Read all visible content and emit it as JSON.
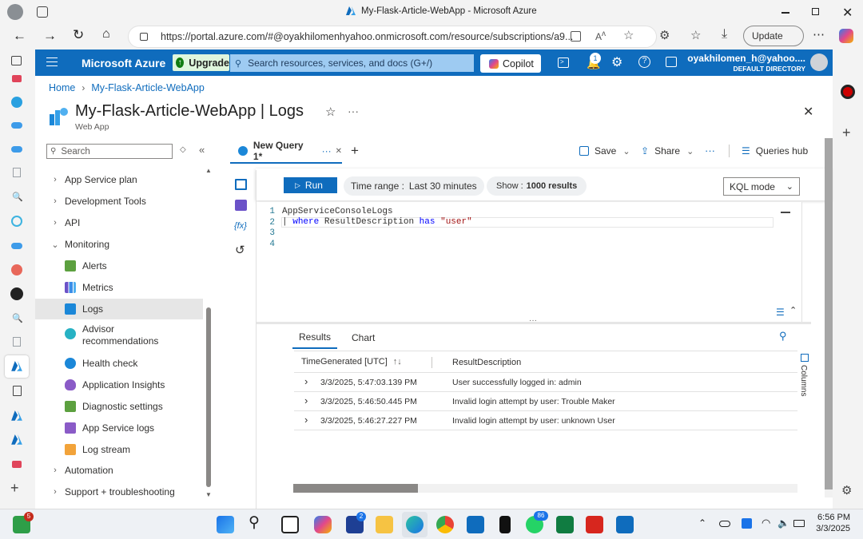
{
  "browser": {
    "tab_title": "My-Flask-Article-WebApp - Microsoft Azure",
    "url": "https://portal.azure.com/#@oyakhilomenhyahoo.onmicrosoft.com/resource/subscriptions/a9...",
    "update_label": "Update"
  },
  "azure": {
    "brand": "Microsoft Azure",
    "upgrade_label": "Upgrade",
    "search_placeholder": "Search resources, services, and docs (G+/)",
    "copilot_label": "Copilot",
    "notification_count": "1",
    "account_name": "oyakhilomen_h@yahoo....",
    "account_dir": "DEFAULT DIRECTORY"
  },
  "breadcrumb": {
    "home": "Home",
    "resource": "My-Flask-Article-WebApp"
  },
  "page": {
    "title": "My-Flask-Article-WebApp | Logs",
    "subtitle": "Web App"
  },
  "sidebar": {
    "search_placeholder": "Search",
    "items": [
      {
        "label": "App Service plan"
      },
      {
        "label": "Development Tools"
      },
      {
        "label": "API"
      },
      {
        "label": "Monitoring"
      },
      {
        "label": "Alerts"
      },
      {
        "label": "Metrics"
      },
      {
        "label": "Logs"
      },
      {
        "label": "Advisor recommendations"
      },
      {
        "label": "Health check"
      },
      {
        "label": "Application Insights"
      },
      {
        "label": "Diagnostic settings"
      },
      {
        "label": "App Service logs"
      },
      {
        "label": "Log stream"
      },
      {
        "label": "Automation"
      },
      {
        "label": "Support + troubleshooting"
      }
    ]
  },
  "query_tab": {
    "label": "New Query 1*"
  },
  "toolbar": {
    "save_label": "Save",
    "share_label": "Share",
    "queries_hub_label": "Queries hub",
    "run_label": "Run",
    "time_range_prefix": "Time range :",
    "time_range_value": "Last 30 minutes",
    "show_prefix": "Show :",
    "show_value": "1000 results",
    "mode_label": "KQL mode"
  },
  "editor": {
    "line_numbers": [
      "1",
      "2",
      "3",
      "4"
    ],
    "line1": "AppServiceConsoleLogs",
    "line2_pipe": "|",
    "line2_kw1": "where",
    "line2_field": "ResultDescription",
    "line2_kw2": "has",
    "line2_str": "\"user\""
  },
  "results": {
    "tabs": [
      "Results",
      "Chart"
    ],
    "columns": [
      "TimeGenerated [UTC]",
      "ResultDescription"
    ],
    "columns_label": "Columns",
    "rows": [
      {
        "time": "3/3/2025, 5:47:03.139 PM",
        "desc": "User successfully logged in: admin"
      },
      {
        "time": "3/3/2025, 5:46:50.445 PM",
        "desc": "Invalid login attempt by user: Trouble Maker"
      },
      {
        "time": "3/3/2025, 5:46:27.227 PM",
        "desc": "Invalid login attempt by user: unknown User"
      }
    ]
  },
  "taskbar": {
    "start_badge": "5",
    "l_badge": "2",
    "whatsapp_badge": "86",
    "time": "6:56 PM",
    "date": "3/3/2025"
  },
  "colors": {
    "azure_blue": "#0f6cbd",
    "run_blue": "#0f6cbd",
    "upgrade_green": "#107c10"
  }
}
